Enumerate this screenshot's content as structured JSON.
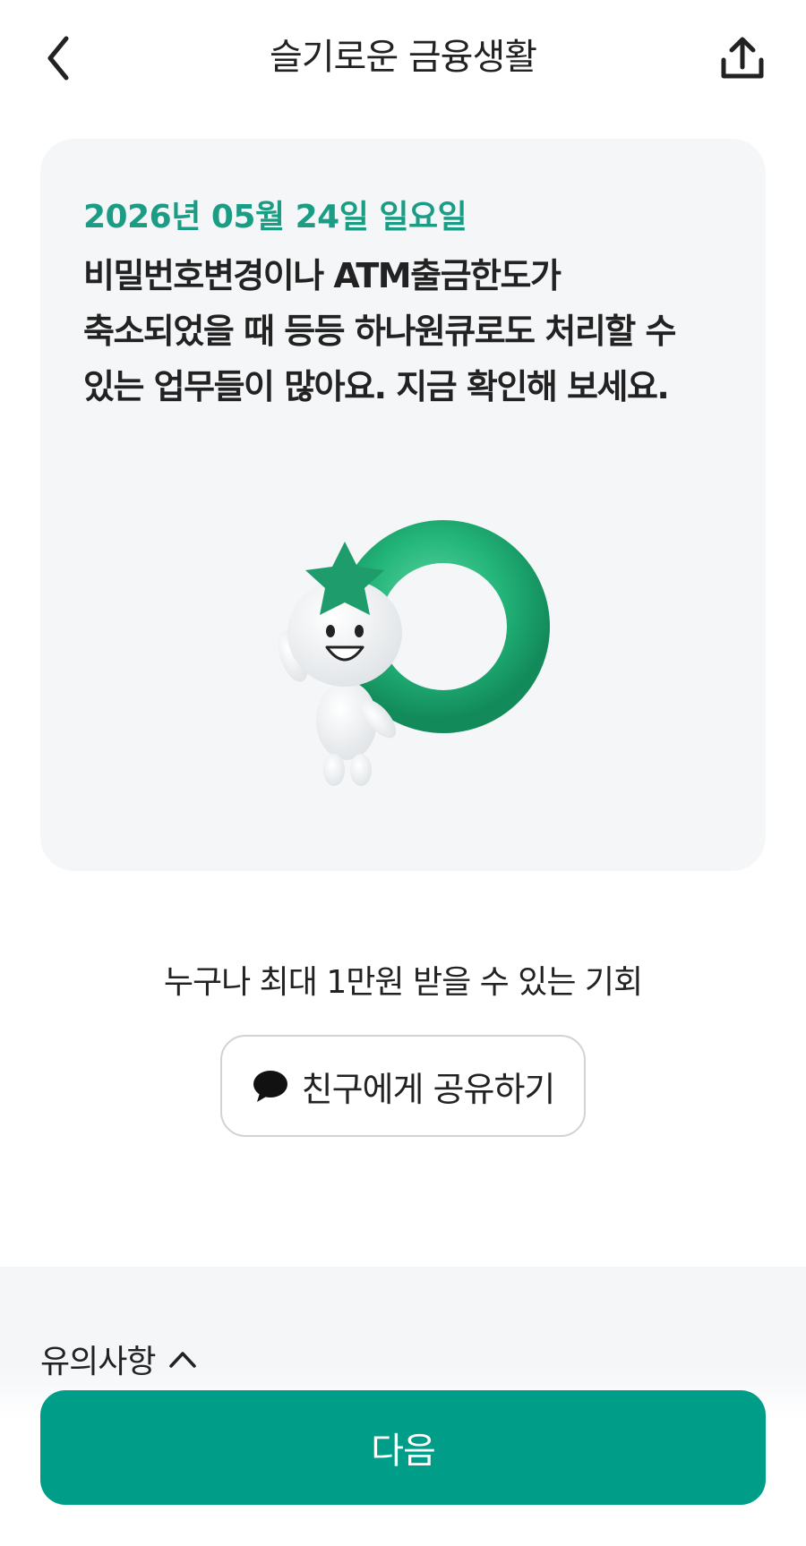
{
  "header": {
    "title": "슬기로운 금융생활",
    "back_icon": "chevron-left-icon",
    "share_icon": "share-upload-icon"
  },
  "card": {
    "date": "2026년 05월 24일 일요일",
    "message_lines": [
      "비밀번호변경이나 ATM출금한도가",
      "축소되었을 때 등등 하나원큐로도 처리할 수",
      "있는 업무들이 많아요. 지금 확인해 보세요."
    ],
    "illustration": "mascot-with-green-ring"
  },
  "promo": {
    "text": "누구나 최대 1만원 받을 수 있는 기회",
    "share_button_label": "친구에게 공유하기",
    "share_button_icon": "speech-bubble-icon"
  },
  "notice": {
    "label": "유의사항",
    "icon": "chevron-up-icon"
  },
  "footer": {
    "next_label": "다음"
  },
  "colors": {
    "accent": "#009e88",
    "date_green": "#1b9c84",
    "card_bg": "#f4f6f8"
  }
}
